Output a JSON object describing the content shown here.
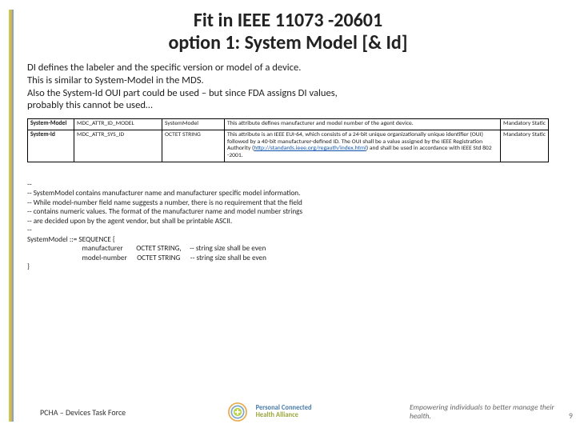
{
  "title_line1": "Fit in IEEE 11073 -20601",
  "title_line2": "option 1: System Model [& Id]",
  "body": {
    "l1": "DI defines the labeler and the specific version or model of a device.",
    "l2": "This is similar to System-Model in the MDS.",
    "l3": "Also the System-Id OUI part could be used – but since FDA assigns DI values,",
    "l4": "probably this cannot be used…"
  },
  "table": {
    "rows": [
      {
        "name": "System-Model",
        "code": "MDC_ATTR_ID_MODEL",
        "type": "SystemModel",
        "desc": "This attribute defines manufacturer and model number of the agent device.",
        "desc_link": "",
        "desc_tail": "",
        "req": "Mandatory Static"
      },
      {
        "name": "System-Id",
        "code": "MDC_ATTR_SYS_ID",
        "type": "OCTET STRING",
        "desc": "This attribute is an IEEE EUI-64, which consists of a 24-bit unique organizationally unique identifier (OUI) followed by a 40-bit manufacturer-defined ID. The OUI shall be a value assigned by the IEEE Registration Authority (",
        "desc_link": "http://standards.ieee.org/regauth/index.html",
        "desc_tail": ") and shall be used in accordance with IEEE Std 802 -2001.",
        "req": "Mandatory Static"
      }
    ]
  },
  "asn": {
    "c0": "--",
    "c1": "-- SystemModel contains manufacturer name and manufacturer specific model information.",
    "c2": "-- While model-number field name suggests a number, there is no requirement that the field",
    "c3": "-- contains numeric values. The format of the manufacturer name and model number strings",
    "c4": "-- are decided upon by the agent vendor, but shall be printable ASCII.",
    "c5": "--",
    "l0": "SystemModel ::= SEQUENCE {",
    "l1": "                                 manufacturer        OCTET STRING,     -- string size shall be even",
    "l2": "                                 model-number      OCTET STRING      -- string size shall be even",
    "l3": "}"
  },
  "footer": {
    "task": "PCHA – Devices Task Force",
    "brand_top": "Personal Connected",
    "brand_bot": "Health Alliance",
    "tag": "Empowering individuals to better manage their health."
  },
  "page": "9"
}
